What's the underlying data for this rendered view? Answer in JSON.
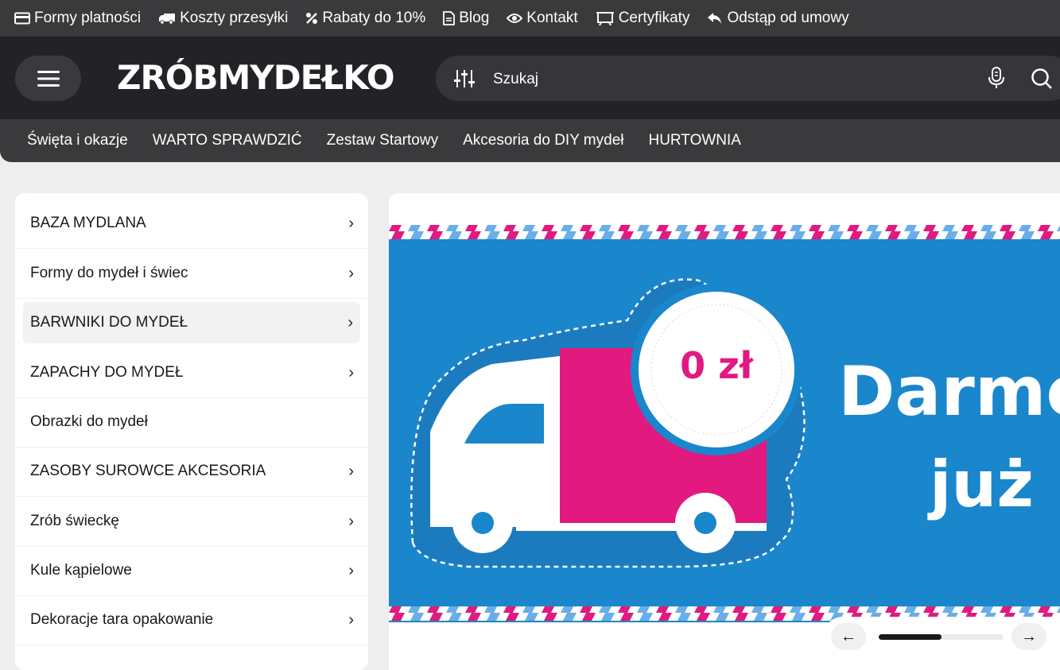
{
  "topbar": {
    "items": [
      {
        "label": "Formy platności",
        "icon": "credit-card-icon"
      },
      {
        "label": "Koszty przesyłki",
        "icon": "truck-icon"
      },
      {
        "label": "Rabaty do 10%",
        "icon": "percent-icon"
      },
      {
        "label": "Blog",
        "icon": "document-icon"
      },
      {
        "label": "Kontakt",
        "icon": "eye-icon"
      },
      {
        "label": "Certyfikaty",
        "icon": "certificate-icon"
      },
      {
        "label": "Odstąp od umowy",
        "icon": "reply-icon"
      }
    ]
  },
  "header": {
    "logo": "ZRÓBMYDEŁKO",
    "search_placeholder": "Szukaj"
  },
  "catnav": {
    "items": [
      "Święta i okazje",
      "WARTO SPRAWDZIĆ",
      "Zestaw Startowy",
      "Akcesoria do DIY mydeł",
      "HURTOWNIA"
    ]
  },
  "sidebar": {
    "items": [
      {
        "label": "BAZA MYDLANA",
        "chevron": "›"
      },
      {
        "label": "Formy do mydeł i świec",
        "chevron": "›"
      },
      {
        "label": "BARWNIKI DO MYDEŁ",
        "chevron": "›"
      },
      {
        "label": "ZAPACHY DO MYDEŁ",
        "chevron": "›"
      },
      {
        "label": "Obrazki do mydeł",
        "chevron": ""
      },
      {
        "label": "ZASOBY SUROWCE AKCESORIA",
        "chevron": "›"
      },
      {
        "label": "Zrób świeckę",
        "chevron": "›"
      },
      {
        "label": "Kule kąpielowe",
        "chevron": "›"
      },
      {
        "label": "Dekoracje tara opakowanie",
        "chevron": "›"
      }
    ]
  },
  "banner": {
    "price": "0 zł",
    "headline": "Darmo",
    "subline": "już"
  },
  "slider": {
    "prev": "←",
    "next": "→",
    "progress": 0.5
  },
  "colors": {
    "dark_bg": "#232327",
    "bar_bg": "#3a3a3c",
    "banner_blue": "#1a86cc",
    "banner_pink": "#e2197f"
  }
}
